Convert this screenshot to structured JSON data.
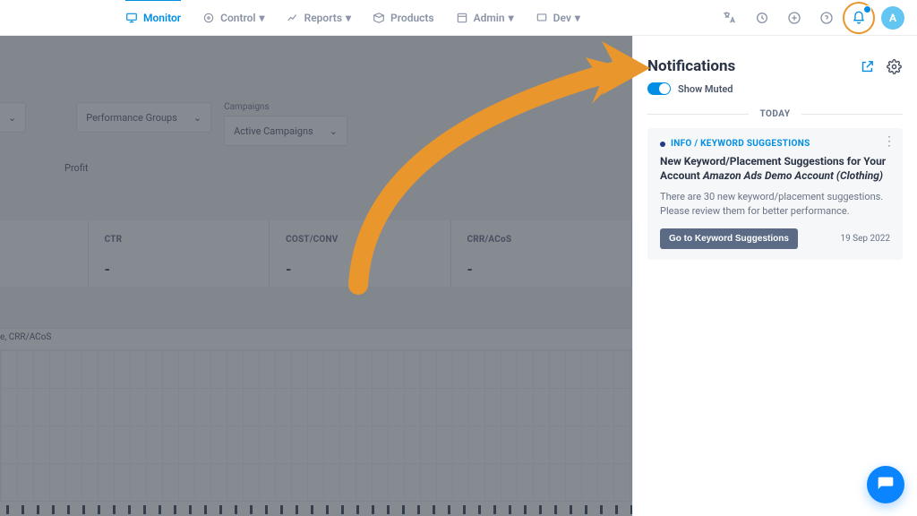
{
  "nav": {
    "monitor": "Monitor",
    "control": "Control",
    "reports": "Reports",
    "products": "Products",
    "admin": "Admin",
    "dev": "Dev"
  },
  "avatar_initial": "A",
  "filters": {
    "perf_groups": "Performance Groups",
    "campaigns_label": "Campaigns",
    "campaigns_value": "Active Campaigns"
  },
  "tabs": {
    "profit": "Profit"
  },
  "metrics": [
    {
      "label": "CTR",
      "value": "-"
    },
    {
      "label": "COST/CONV",
      "value": "-"
    },
    {
      "label": "CRR/ACoS",
      "value": "-"
    }
  ],
  "chart_caption": "e, CRR/ACoS",
  "panel": {
    "title": "Notifications",
    "show_muted": "Show Muted",
    "show_muted_on": true,
    "divider": "TODAY",
    "notif": {
      "category": "INFO / KEYWORD SUGGESTIONS",
      "title1": "New Keyword/Placement Suggestions for Your Account ",
      "title2": "Amazon Ads Demo Account (Clothing)",
      "desc": "There are 30 new keyword/placement suggestions. Please review them for better performance.",
      "button": "Go to Keyword Suggestions",
      "date": "19 Sep 2022"
    }
  }
}
